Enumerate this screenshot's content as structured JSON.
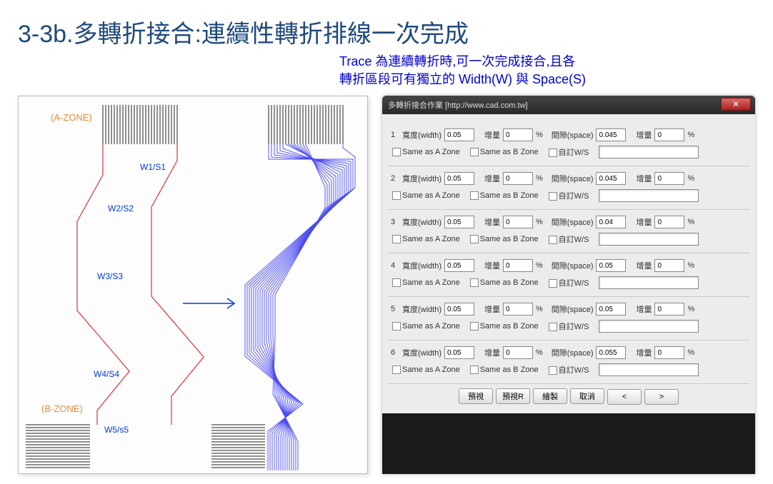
{
  "title": "3-3b.多轉折接合:連續性轉折排線一次完成",
  "subtitle_l1": "Trace 為連續轉折時,可一次完成接合,且各",
  "subtitle_l2": "轉折區段可有獨立的 Width(W) 與 Space(S)",
  "zones": {
    "a": "(A-ZONE)",
    "b": "(B-ZONE)"
  },
  "segs": [
    "W1/S1",
    "W2/S2",
    "W3/S3",
    "W4/S4",
    "W5/s5"
  ],
  "dialog_title": "多轉折接合作業 [http://www.cad.com.tw]",
  "labels": {
    "width": "寬度(width)",
    "inc": "增量",
    "pct": "%",
    "space": "間隙(space)",
    "sameA": "Same as A Zone",
    "sameB": "Same as B Zone",
    "custom": "自訂W/S"
  },
  "rows": [
    {
      "n": "1",
      "w": "0.05",
      "winc": "0",
      "s": "0.045",
      "sinc": "0"
    },
    {
      "n": "2",
      "w": "0.05",
      "winc": "0",
      "s": "0.045",
      "sinc": "0"
    },
    {
      "n": "3",
      "w": "0.05",
      "winc": "0",
      "s": "0.04",
      "sinc": "0"
    },
    {
      "n": "4",
      "w": "0.05",
      "winc": "0",
      "s": "0.05",
      "sinc": "0"
    },
    {
      "n": "5",
      "w": "0.05",
      "winc": "0",
      "s": "0.05",
      "sinc": "0"
    },
    {
      "n": "6",
      "w": "0.05",
      "winc": "0",
      "s": "0.055",
      "sinc": "0"
    }
  ],
  "buttons": [
    "預視",
    "預視R",
    "繪製",
    "取消",
    "<",
    ">"
  ]
}
